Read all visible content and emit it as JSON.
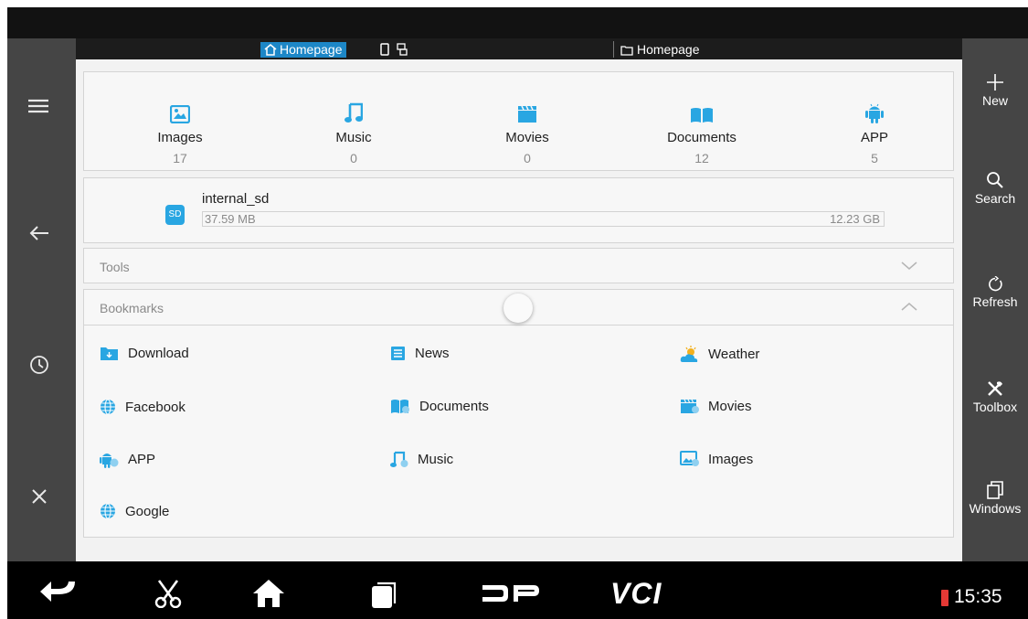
{
  "tabs": {
    "active_label": "Homepage",
    "right_label": "Homepage"
  },
  "categories": [
    {
      "label": "Images",
      "count": "17",
      "icon": "image-icon"
    },
    {
      "label": "Music",
      "count": "0",
      "icon": "music-icon"
    },
    {
      "label": "Movies",
      "count": "0",
      "icon": "movie-icon"
    },
    {
      "label": "Documents",
      "count": "12",
      "icon": "book-icon"
    },
    {
      "label": "APP",
      "count": "5",
      "icon": "android-icon"
    }
  ],
  "storage": {
    "name": "internal_sd",
    "icon_text": "SD",
    "used": "37.59 MB",
    "total": "12.23 GB"
  },
  "sections": {
    "tools": "Tools",
    "bookmarks": "Bookmarks"
  },
  "bookmarks": [
    {
      "label": "Download",
      "icon": "download-folder-icon"
    },
    {
      "label": "News",
      "icon": "news-icon"
    },
    {
      "label": "Weather",
      "icon": "weather-icon"
    },
    {
      "label": "Facebook",
      "icon": "globe-icon"
    },
    {
      "label": "Documents",
      "icon": "book-icon"
    },
    {
      "label": "Movies",
      "icon": "movie-icon"
    },
    {
      "label": "APP",
      "icon": "android-icon"
    },
    {
      "label": "Music",
      "icon": "music-icon"
    },
    {
      "label": "Images",
      "icon": "image-icon"
    },
    {
      "label": "Google",
      "icon": "globe-icon"
    }
  ],
  "right_actions": [
    {
      "label": "New",
      "icon": "plus-icon"
    },
    {
      "label": "Search",
      "icon": "search-icon"
    },
    {
      "label": "Refresh",
      "icon": "refresh-icon"
    },
    {
      "label": "Toolbox",
      "icon": "tools-icon"
    },
    {
      "label": "Windows",
      "icon": "windows-icon"
    }
  ],
  "left_actions": [
    {
      "icon": "menu-icon"
    },
    {
      "icon": "back-arrow-icon"
    },
    {
      "icon": "history-clock-icon"
    },
    {
      "icon": "close-icon"
    }
  ],
  "nav_bar": {
    "time": "15:35",
    "vci_label": "VCI",
    "dp_label": "DP"
  },
  "colors": {
    "accent": "#1d87c7",
    "icon_blue": "#29a6e2",
    "battery": "#e53935"
  }
}
